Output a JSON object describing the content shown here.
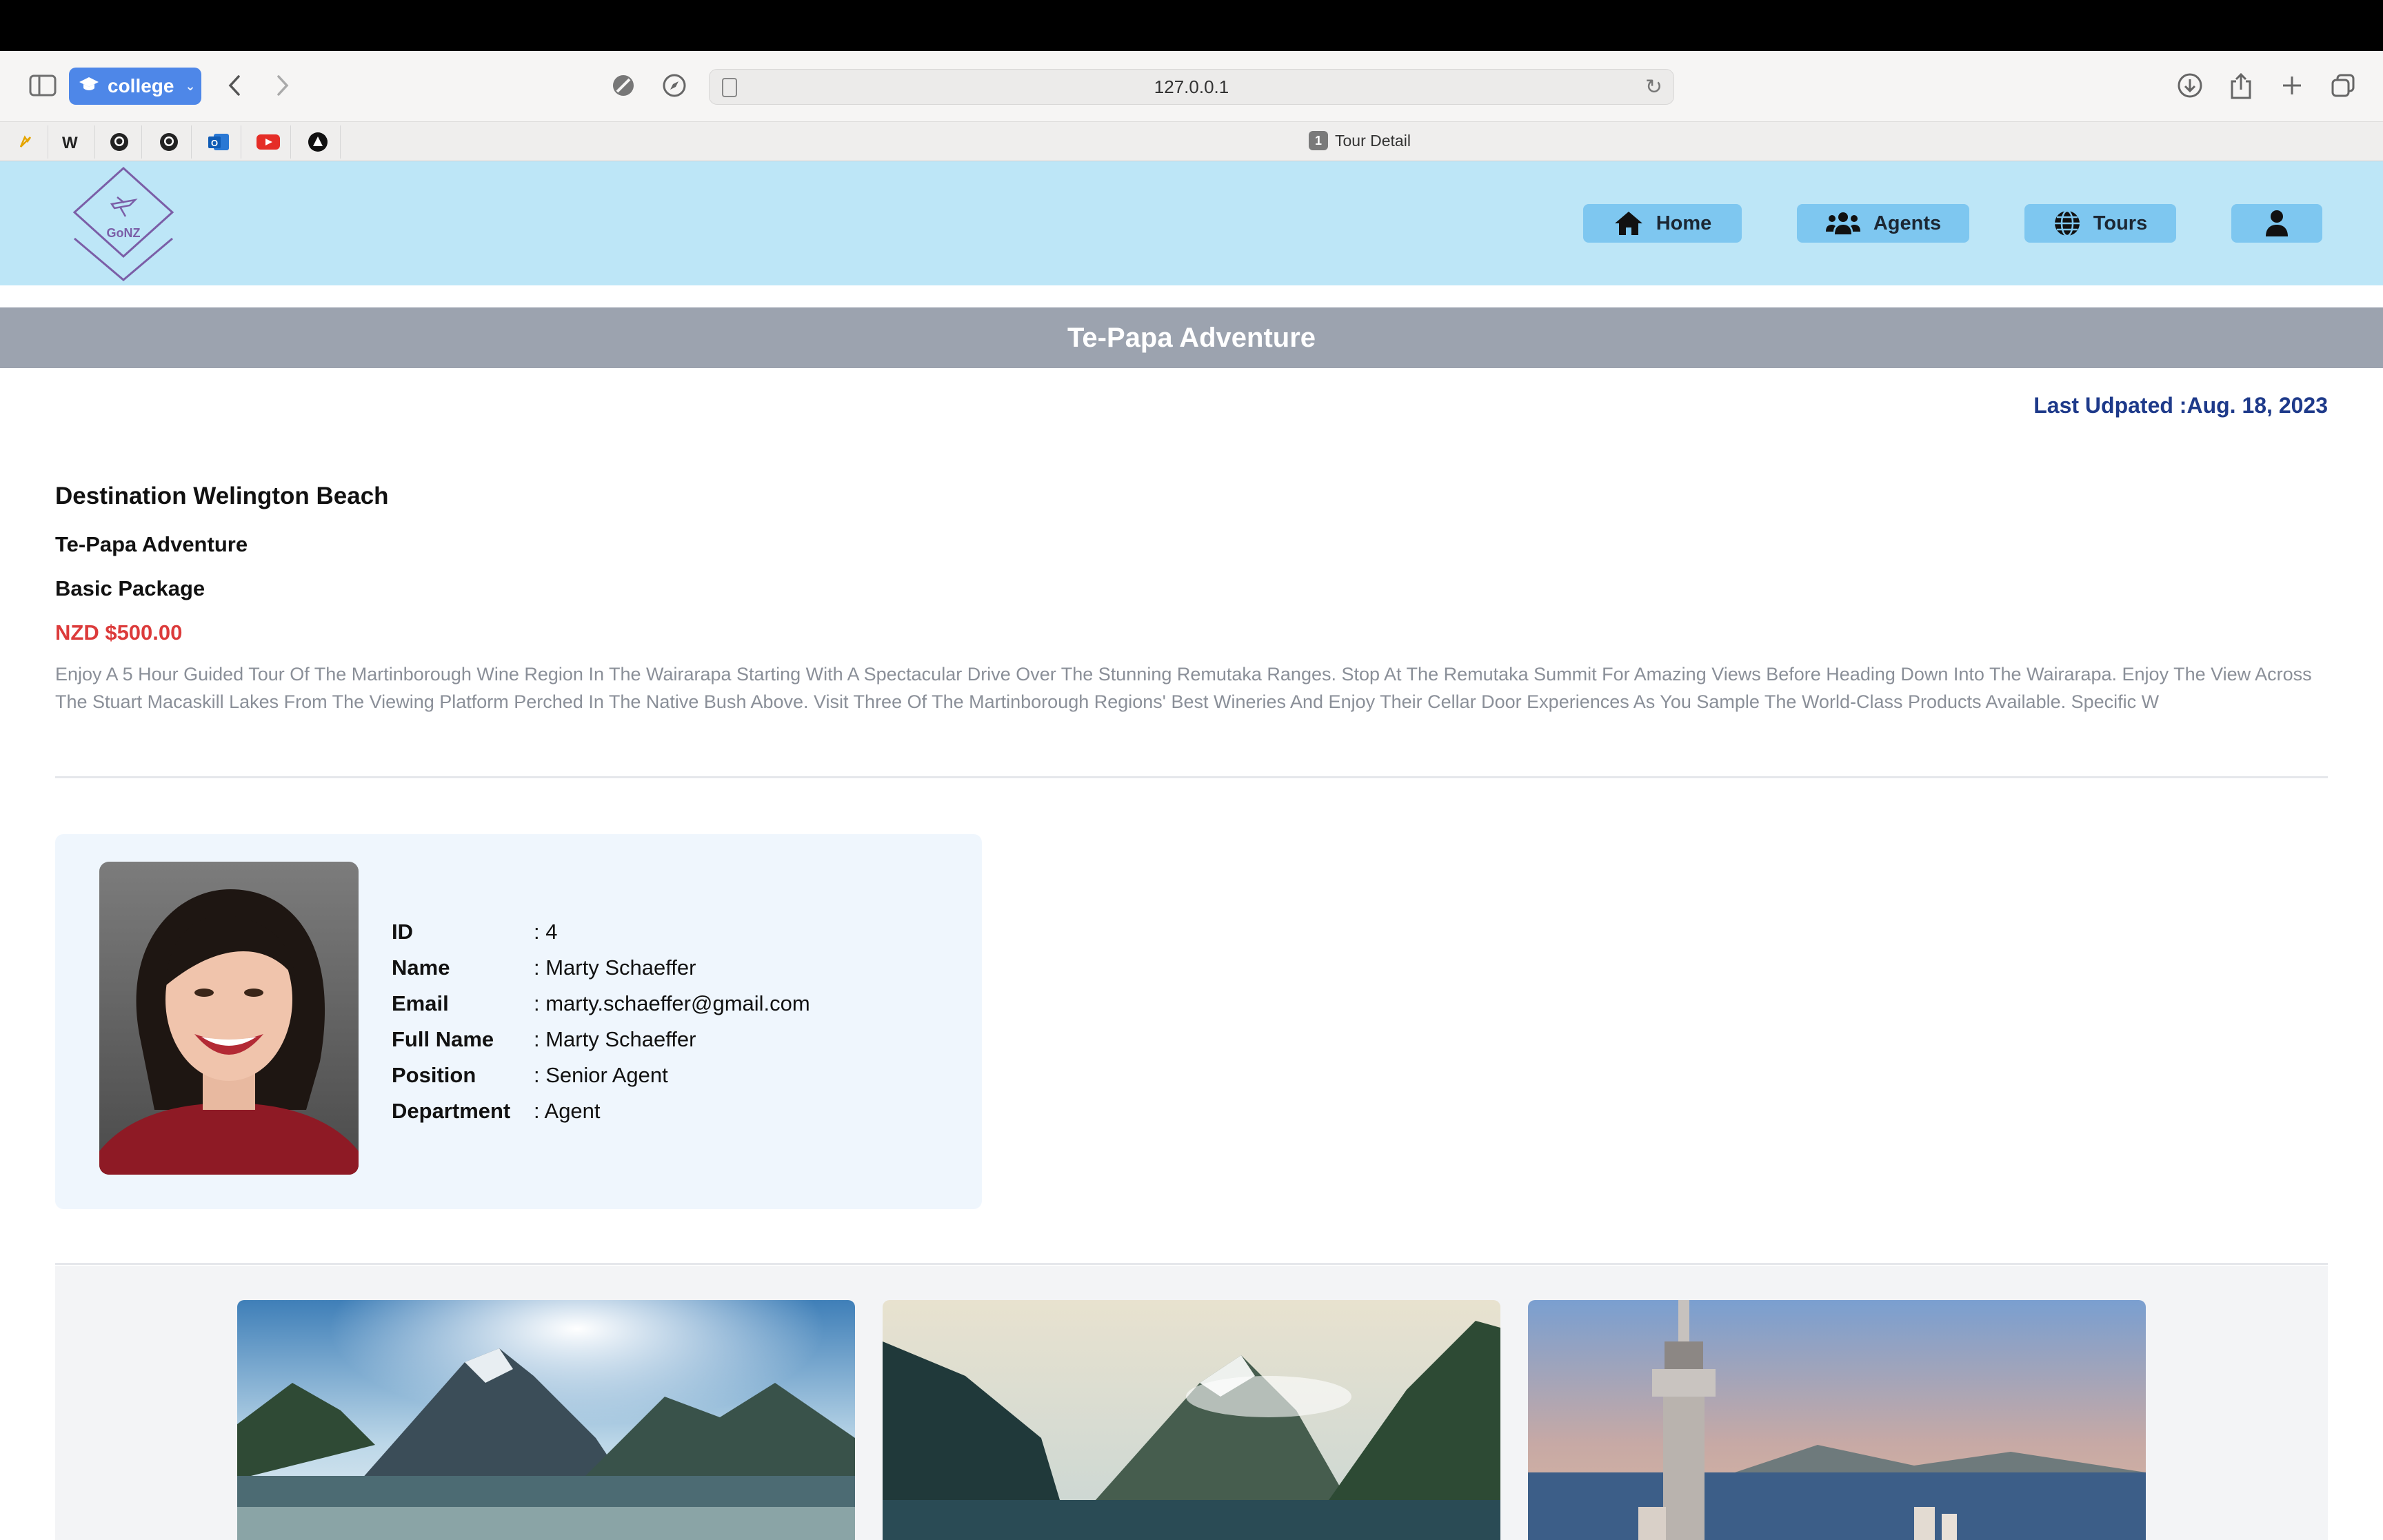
{
  "browser": {
    "profile_label": "college",
    "url": "127.0.0.1",
    "tab_title": "Tour Detail",
    "tab_count": "1",
    "favorites": [
      "app-icon",
      "w-icon",
      "github-icon",
      "github-icon",
      "outlook-icon",
      "youtube-icon",
      "triangle-icon"
    ]
  },
  "site": {
    "logo_text": "GoNZ",
    "nav": {
      "home": "Home",
      "agents": "Agents",
      "tours": "Tours"
    },
    "page_title": "Te-Papa Adventure",
    "last_updated": "Last Udpated :Aug. 18, 2023"
  },
  "tour": {
    "destination": "Destination Welington Beach",
    "name": "Te-Papa Adventure",
    "package": "Basic Package",
    "price": "NZD $500.00",
    "description": "Enjoy A 5 Hour Guided Tour Of The Martinborough Wine Region In The Wairarapa Starting With A Spectacular Drive Over The Stunning Remutaka Ranges. Stop At The Remutaka Summit For Amazing Views Before Heading Down Into The Wairarapa. Enjoy The View Across The Stuart Macaskill Lakes From The Viewing Platform Perched In The Native Bush Above. Visit Three Of The Martinborough Regions' Best Wineries And Enjoy Their Cellar Door Experiences As You Sample The World-Class Products Available. Specific W"
  },
  "agent": {
    "rows": [
      {
        "label": "ID",
        "value": ": 4"
      },
      {
        "label": "Name",
        "value": ": Marty Schaeffer"
      },
      {
        "label": "Email",
        "value": ": marty.schaeffer@gmail.com"
      },
      {
        "label": "Full Name",
        "value": ": Marty Schaeffer"
      },
      {
        "label": "Position",
        "value": ": Senior Agent"
      },
      {
        "label": "Department",
        "value": ": Agent"
      }
    ]
  },
  "colors": {
    "header_bg": "#bde6f7",
    "nav_button": "#7ec7f0",
    "title_bar": "#9ca3af",
    "price": "#dc3b3b",
    "last_updated": "#1e3a8a"
  }
}
